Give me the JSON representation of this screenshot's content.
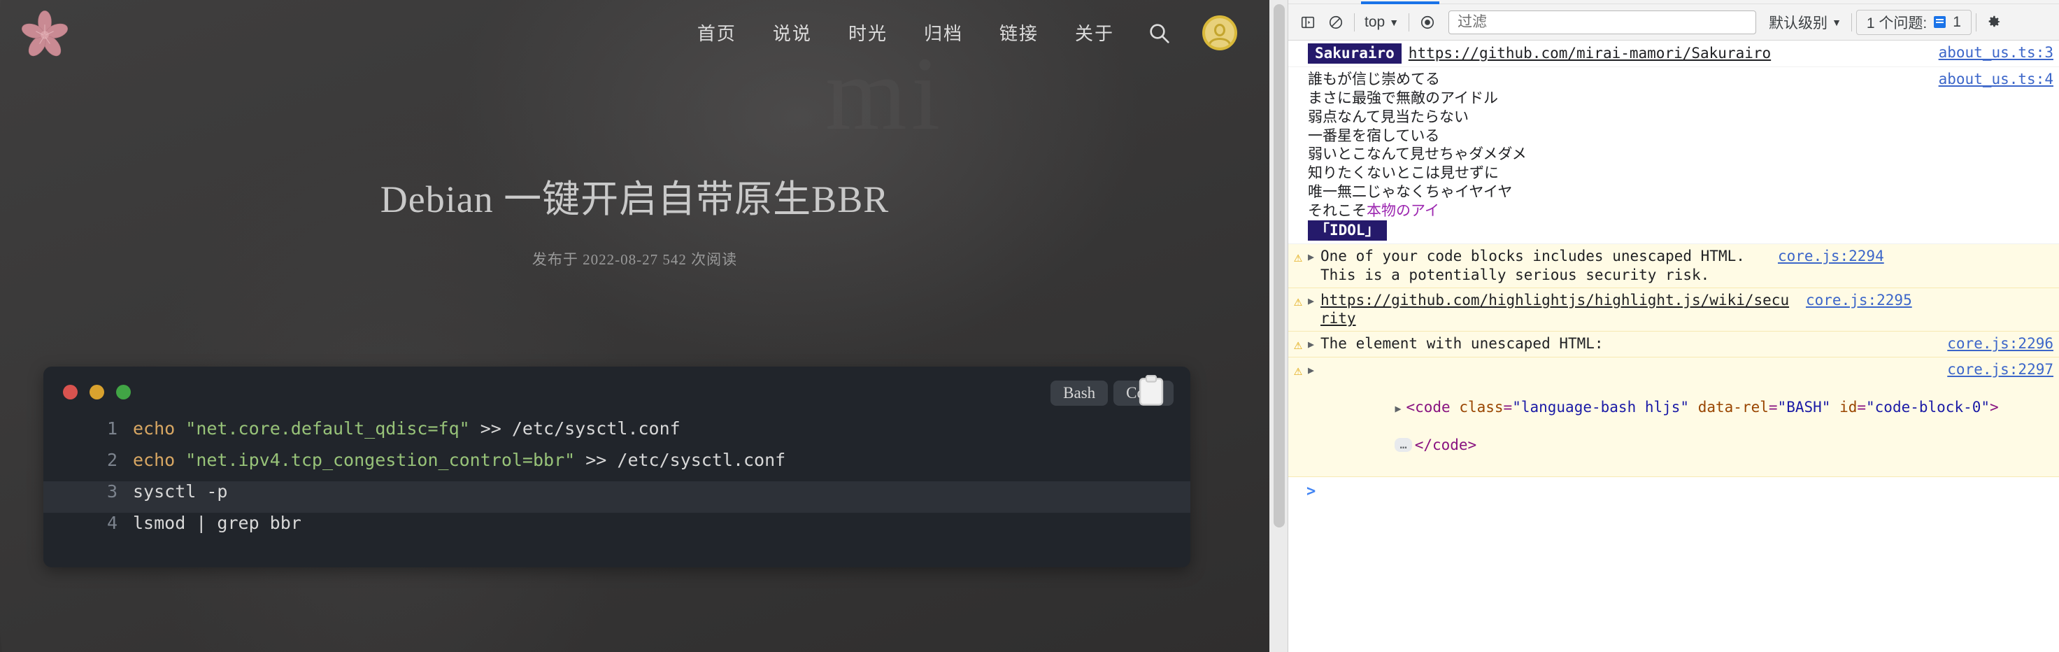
{
  "site": {
    "logo_icon": "cherry-blossom-icon",
    "watermark_text": "mi",
    "nav_items": [
      {
        "label": "首页"
      },
      {
        "label": "说说"
      },
      {
        "label": "时光"
      },
      {
        "label": "归档"
      },
      {
        "label": "链接"
      },
      {
        "label": "关于"
      }
    ],
    "search_icon": "search-icon",
    "avatar_icon": "user-avatar-icon",
    "post": {
      "title": "Debian 一键开启自带原生BBR",
      "meta": "发布于 2022-08-27  542 次阅读"
    },
    "code_block": {
      "language_label": "Bash",
      "copy_label": "Copy",
      "cursor_icon": "clipboard-cursor-icon",
      "window_dots": [
        "#d9534f",
        "#d9a22e",
        "#41a545"
      ],
      "lines": [
        {
          "n": "1",
          "cmd": "echo",
          "str": "\"net.core.default_qdisc=fq\"",
          "rest": " >> /etc/sysctl.conf",
          "highlighted": false
        },
        {
          "n": "2",
          "cmd": "echo",
          "str": "\"net.ipv4.tcp_congestion_control=bbr\"",
          "rest": " >> /etc/sysctl.conf",
          "highlighted": false
        },
        {
          "n": "3",
          "cmd": "",
          "str": "",
          "rest": "sysctl -p",
          "highlighted": true
        },
        {
          "n": "4",
          "cmd": "",
          "str": "",
          "rest": "lsmod | grep bbr",
          "highlighted": false
        }
      ]
    }
  },
  "devtools": {
    "toolbar": {
      "sidebar_toggle_icon": "console-sidebar-icon",
      "clear_icon": "clear-console-icon",
      "context_label": "top",
      "context_caret": "▼",
      "eye_icon": "live-expression-icon",
      "filter_placeholder": "过滤",
      "filter_value": "",
      "level_label": "默认级别",
      "level_caret": "▼",
      "issues_label": "1 个问题:",
      "issues_count": "1",
      "issues_icon": "issues-icon",
      "settings_icon": "gear-icon"
    },
    "messages": [
      {
        "type": "log",
        "badge": "Sakurairo",
        "text": "https://github.com/mirai-mamori/Sakurairo",
        "source": "about_us.ts:3"
      },
      {
        "type": "lyrics",
        "lines": [
          "誰もが信じ崇めてる",
          "まさに最強で無敵のアイドル",
          "弱点なんて見当たらない",
          "一番星を宿している",
          "弱いとこなんて見せちゃダメダメ",
          "知りたくないとこは見せずに",
          "唯一無二じゃなくちゃイヤイヤ"
        ],
        "last_line_prefix": "それこそ",
        "last_line_highlight": "本物のアイ",
        "idol_badge": "「IDOL」",
        "source": "about_us.ts:4"
      },
      {
        "type": "warning",
        "text": "One of your code blocks includes unescaped HTML. This is a potentially serious security risk.",
        "source": "core.js:2294"
      },
      {
        "type": "warning-link",
        "text": "https://github.com/highlightjs/highlight.js/wiki/security",
        "source": "core.js:2295"
      },
      {
        "type": "warning",
        "text": "The element with unescaped HTML:",
        "source": "core.js:2296"
      },
      {
        "type": "warning-html",
        "source": "core.js:2297",
        "html": {
          "open_lt": "<",
          "tag": "code",
          "attrs": [
            {
              "name": "class",
              "value": "\"language-bash hljs\""
            },
            {
              "name": "data-rel",
              "value": "\"BASH\""
            },
            {
              "name": "id",
              "value": "\"code-block-0\""
            }
          ],
          "open_gt": ">",
          "ellipsis": "…",
          "close_tag": "</code>"
        }
      }
    ],
    "prompt_chevron": ">"
  }
}
